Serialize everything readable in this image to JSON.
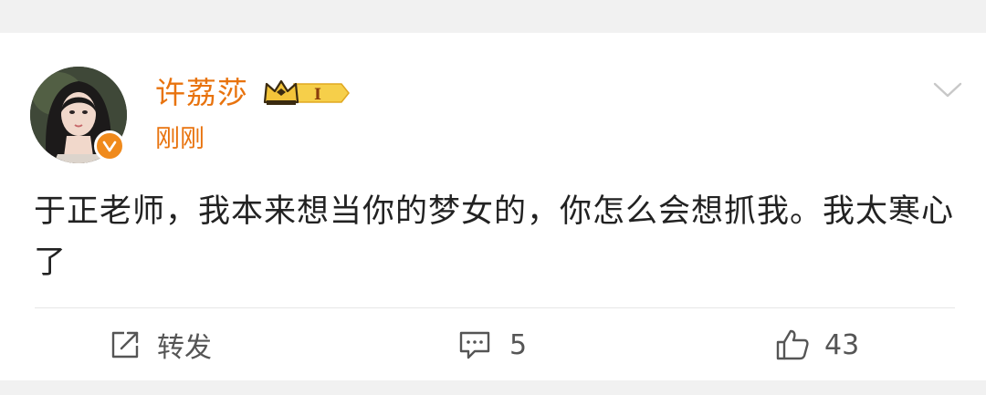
{
  "post": {
    "author": {
      "name": "许荔莎",
      "vip_level": "I",
      "verified": true
    },
    "timestamp": "刚刚",
    "text": "于正老师，我本来想当你的梦女的，你怎么会想抓我。我太寒心了"
  },
  "actions": {
    "repost_label": "转发",
    "comment_count": "5",
    "like_count": "43"
  },
  "icons": {
    "menu": "chevron-down-icon",
    "repost": "share-square-icon",
    "comment": "comment-bubble-icon",
    "like": "thumbs-up-icon",
    "verified": "verified-check-icon",
    "vip": "crown-icon"
  },
  "colors": {
    "accent": "#e8730e",
    "verified": "#f08a1c",
    "vip_gold": "#f3c43a"
  }
}
